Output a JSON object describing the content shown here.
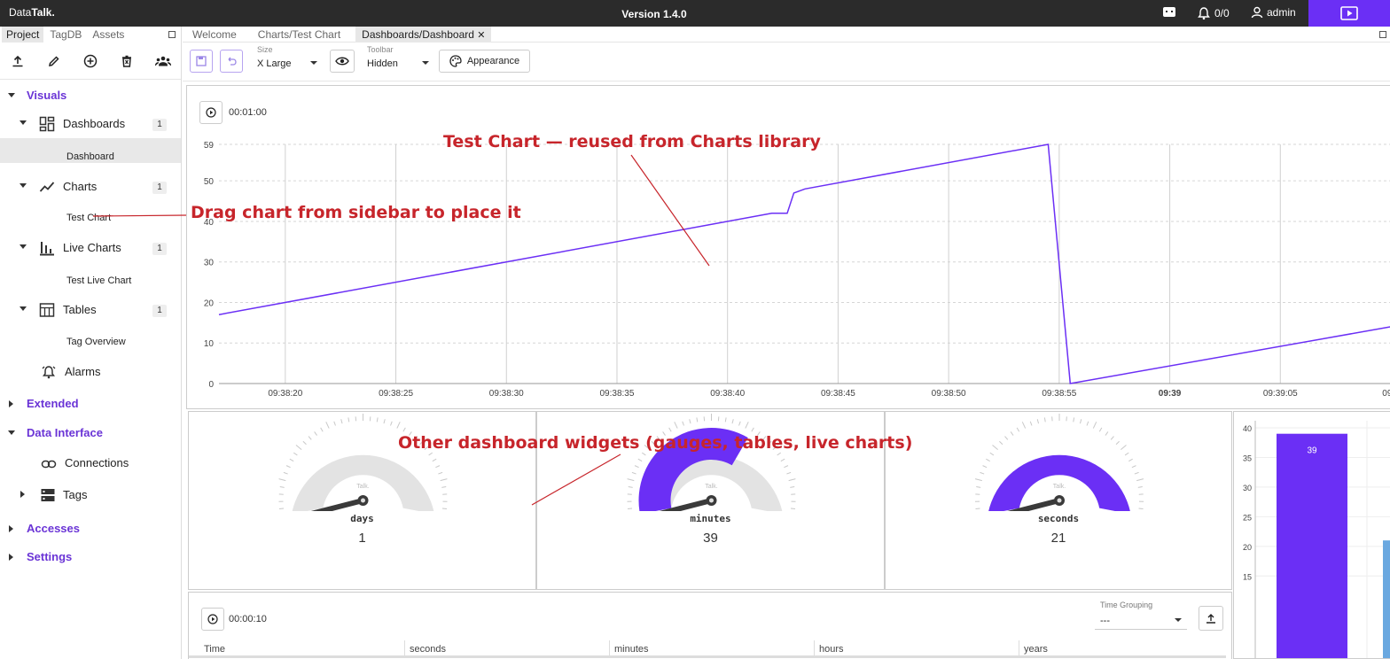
{
  "topbar": {
    "brand_plain": "Data",
    "brand_bold": "Talk.",
    "version": "Version 1.4.0",
    "alarms": "0/0",
    "user": "admin"
  },
  "sidebar": {
    "tabs": [
      "Project",
      "TagDB",
      "Assets"
    ],
    "tree": {
      "visuals": "Visuals",
      "dashboards": "Dashboards",
      "dashboards_count": "1",
      "dashboard": "Dashboard",
      "charts": "Charts",
      "charts_count": "1",
      "test_chart": "Test Chart",
      "live_charts": "Live Charts",
      "live_charts_count": "1",
      "test_live_chart": "Test Live Chart",
      "tables": "Tables",
      "tables_count": "1",
      "tag_overview": "Tag Overview",
      "alarms": "Alarms",
      "extended": "Extended",
      "data_interface": "Data Interface",
      "connections": "Connections",
      "tags": "Tags",
      "accesses": "Accesses",
      "settings": "Settings"
    }
  },
  "main": {
    "tabs": [
      "Welcome",
      "Charts/Test Chart",
      "Dashboards/Dashboard"
    ],
    "close_glyph": "✕",
    "toolbar": {
      "size_label": "Size",
      "size_value": "X Large",
      "toolbar_label": "Toolbar",
      "toolbar_value": "Hidden",
      "appearance": "Appearance"
    },
    "line_chart": {
      "duration": "00:01:00"
    },
    "gauges": [
      {
        "label": "days",
        "value": "1",
        "fill": 0.0
      },
      {
        "label": "minutes",
        "value": "39",
        "fill": 0.65
      },
      {
        "label": "seconds",
        "value": "21",
        "fill": 1.0
      }
    ],
    "gauge_watermark": "Talk.",
    "table": {
      "duration": "00:00:10",
      "grouping_label": "Time Grouping",
      "grouping_value": "---",
      "columns": [
        "Time",
        "seconds",
        "minutes",
        "hours",
        "years"
      ]
    }
  },
  "annotations": {
    "chart": "Test Chart — reused from Charts library",
    "drag": "Drag chart from sidebar to place it",
    "widgets": "Other dashboard widgets (gauges, tables, live charts)"
  },
  "colors": {
    "accent": "#6b2ff5",
    "section": "#6a34d6",
    "annotation": "#c7252b",
    "bar2": "#6aa8e0"
  },
  "chart_data": [
    {
      "type": "line",
      "x": [
        "09:38:17",
        "09:38:42",
        "09:38:42.7",
        "09:38:43",
        "09:38:43.5",
        "09:38:54.5",
        "09:38:55.5",
        "09:39:10"
      ],
      "y": [
        17,
        42,
        42,
        47,
        48,
        59,
        0,
        14
      ],
      "xticks": [
        "09:38:20",
        "09:38:25",
        "09:38:30",
        "09:38:35",
        "09:38:40",
        "09:38:45",
        "09:38:50",
        "09:38:55",
        "09:39",
        "09:39:05",
        "09:3"
      ],
      "yticks": [
        "0",
        "10",
        "20",
        "30",
        "40",
        "50",
        "59"
      ],
      "ylim": [
        0,
        59
      ],
      "color": "#6b2ff5",
      "grid": true
    },
    {
      "type": "bar",
      "values": [
        39,
        21
      ],
      "data_labels": [
        "39",
        ""
      ],
      "yticks": [
        "15",
        "20",
        "25",
        "30",
        "35",
        "40"
      ],
      "ylim": [
        12,
        40
      ]
    }
  ]
}
